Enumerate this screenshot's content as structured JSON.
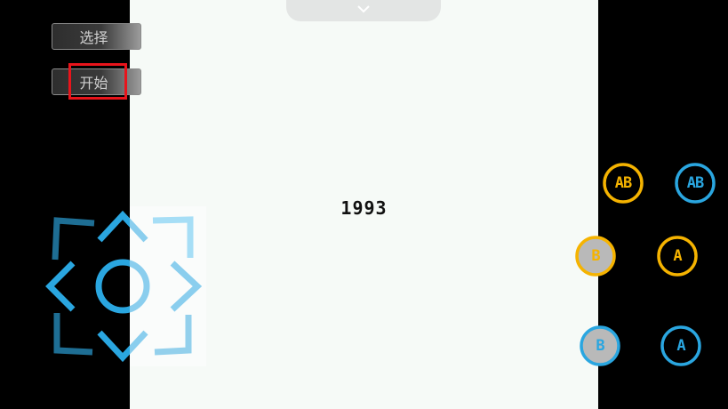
{
  "controls": {
    "select_label": "选择",
    "start_label": "开始"
  },
  "screen": {
    "year_text": "1993",
    "pull_tab_icon": "chevron-down-icon"
  },
  "buttons": {
    "turbo_ab_yellow": "AB",
    "turbo_ab_blue": "AB",
    "turbo_b_yellow": "B",
    "turbo_a_yellow": "A",
    "b_blue": "B",
    "a_blue": "A"
  },
  "colors": {
    "yellow": "#f5b300",
    "blue": "#2aa6e0",
    "highlight": "#e8141b",
    "screen_bg": "#f6faf7"
  }
}
